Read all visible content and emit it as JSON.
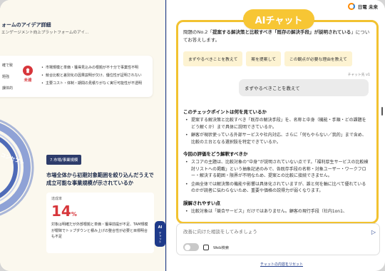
{
  "left": {
    "title": "ォームのアイデア詳細",
    "subtitle": "エンゲージメント向上プラットフォームのアイ…",
    "side_labels": [
      "確で致",
      "題強",
      "課体的"
    ],
    "badge_text": "未達",
    "bullets": [
      "市場規模と単価・獲得見込みの根拠が不十分で事業性不明",
      "競合比較と差別化の因果説明が欠け、優位性が証明されない",
      "主要コスト・体制・期間の見積りがなく実行可能性が不透明"
    ],
    "ring_text": "コンセプト",
    "strategy": {
      "tag": "7.市場/事業規模",
      "heading": "市場全体から初期対象範囲を絞り込んだうえで成立可能な事業規模が示されているか",
      "metric_label": "達成率",
      "metric_value": "14",
      "metric_unit": "%",
      "description": "対象は明確だが外部根拠と単価・獲得前提が不足、TAM規模が曖昧でトップダウンと積み上げの整合性が必要と目標明合も不足"
    }
  },
  "collapse": {
    "ai": "AI",
    "label": "チャット"
  },
  "brand": {
    "name": "日電 未来"
  },
  "chat": {
    "title": "AIチャット",
    "question_prefix": "問題のNo.2「",
    "question_bold": "提案する解決策と比較すべき「既存の解決手段」が説明されている",
    "question_suffix": "」についてお答えします。",
    "chips": [
      "まずやるべきことを教えて",
      "案を提案して",
      "この観点が必要な理由を教えて"
    ],
    "chip_meta": "チャット先 v1",
    "user_message": "まずやるべきことを教えて",
    "answer": {
      "h1": "このチェックポイントは何を見ているか",
      "items1": [
        "提案する解決策と比較すべき「既存の解決手段」を、名称と中身（機能・手順・どの課題をどう解くか）まで具体に説明できているか。",
        "顧客が現状使っている外部サービスや社内対応、さらに「何もやらない／我的」まで含め、比較の土台となる選択肢を特定できているか。"
      ],
      "h2": "今回の評価をどう解釈すべきか",
      "items2": [
        "スコアの主題は、比較対象の“中身”が説明されていない点です。「福利厚生サービスの比較検討リストへの掲載」という抽象記述のみで、各既存手段の名称・対象ユーザー・ワークフロー・解決する範囲・限界が不明なため、提案との比較に接続できません。",
        "企画全体では解決策の機能や影響は具体化されていますが、誰と何を軸に比べて優れているのかが読者に伝わらないため、重要や価格の説得力が弱くなります。"
      ],
      "h3": "誤解されやすい点",
      "items3": [
        "比較対象は「競合サービス」だけではありません。顧客の現行手段（社内1on1、"
      ]
    }
  },
  "input": {
    "placeholder": "改善に向けた相談をしてみましょう",
    "web_label": "Web検索",
    "reset_label": "チャットの内容をリセット"
  }
}
